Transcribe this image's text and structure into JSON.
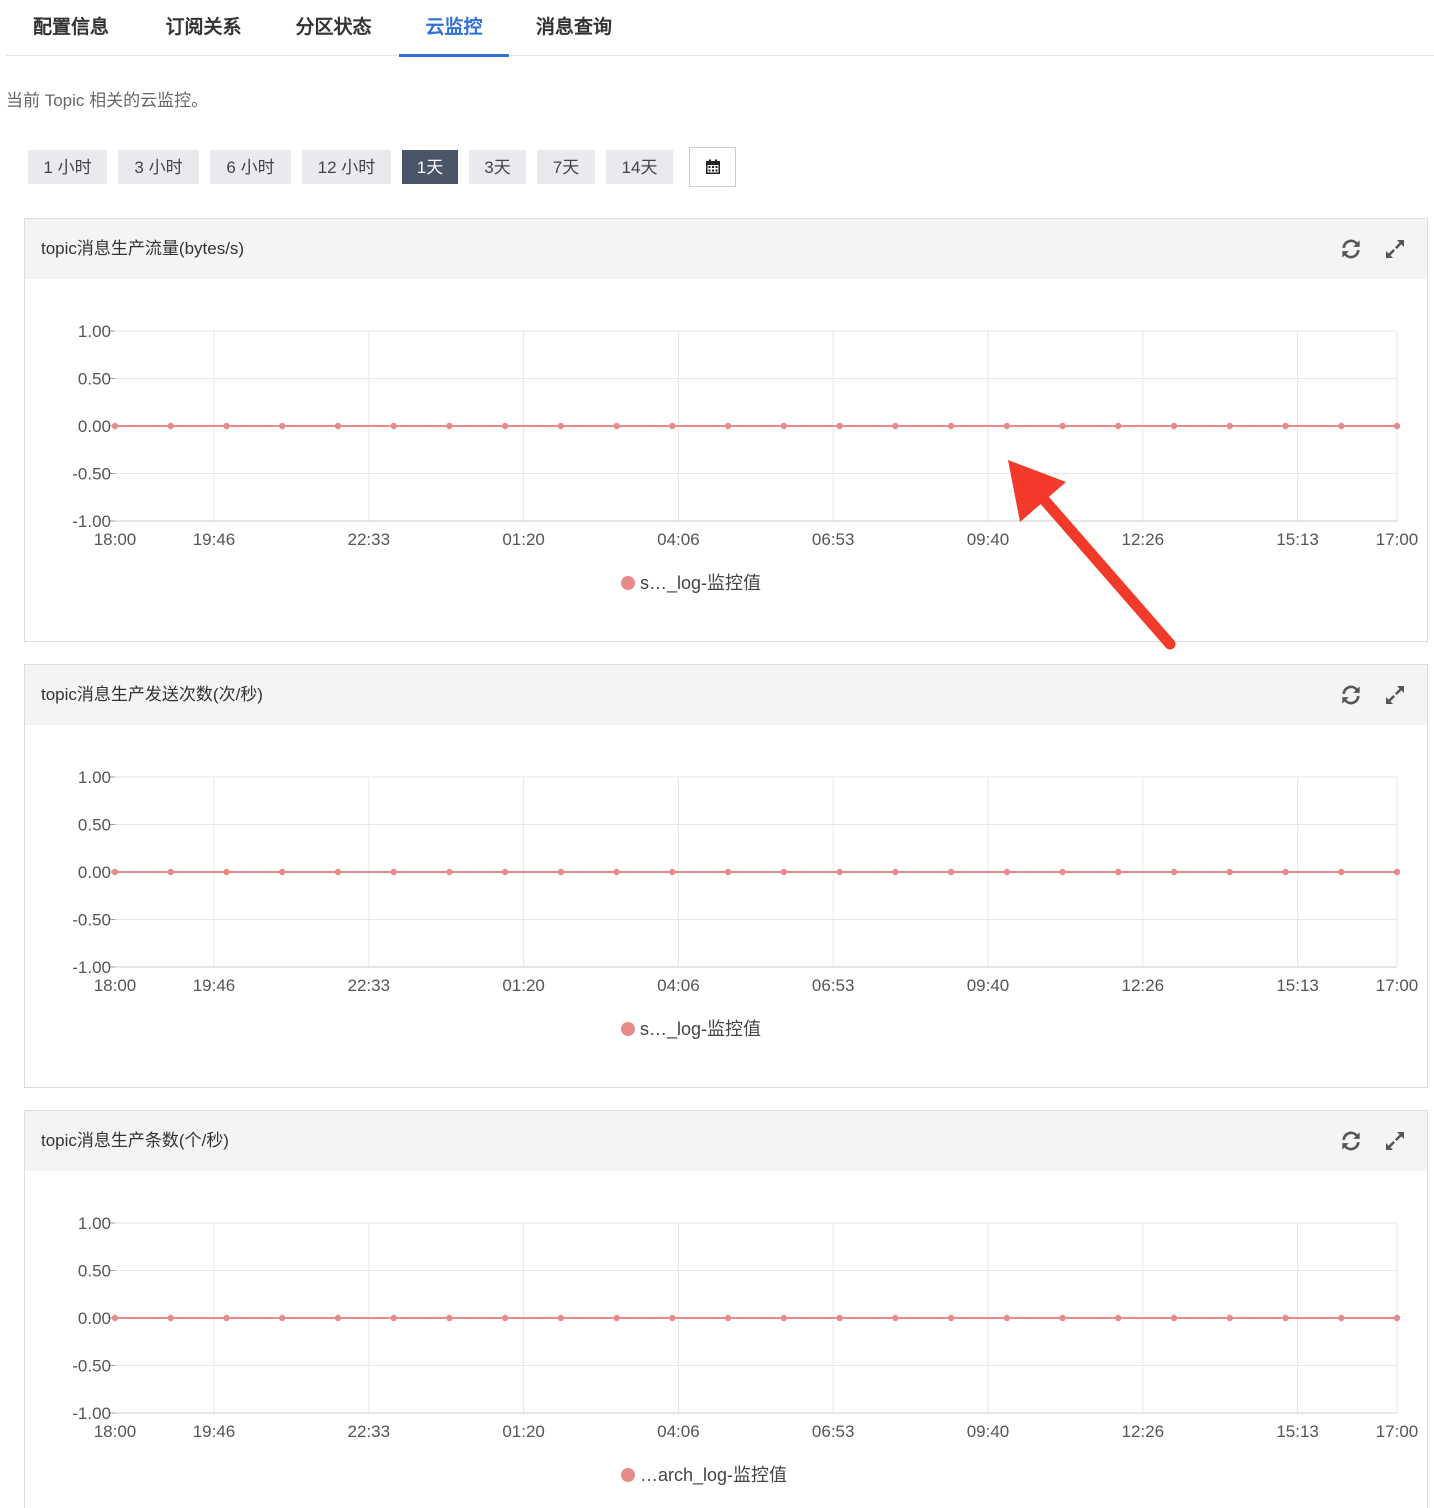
{
  "tabs": [
    {
      "label": "配置信息",
      "active": false
    },
    {
      "label": "订阅关系",
      "active": false
    },
    {
      "label": "分区状态",
      "active": false
    },
    {
      "label": "云监控",
      "active": true
    },
    {
      "label": "消息查询",
      "active": false
    }
  ],
  "description": "当前 Topic 相关的云监控。",
  "time_ranges": [
    {
      "label": "1 小时",
      "active": false
    },
    {
      "label": "3 小时",
      "active": false
    },
    {
      "label": "6 小时",
      "active": false
    },
    {
      "label": "12 小时",
      "active": false
    },
    {
      "label": "1天",
      "active": true
    },
    {
      "label": "3天",
      "active": false
    },
    {
      "label": "7天",
      "active": false
    },
    {
      "label": "14天",
      "active": false
    }
  ],
  "icons": {
    "calendar": "calendar-icon",
    "refresh": "refresh-icon",
    "expand": "expand-icon",
    "arrow": "annotation-arrow"
  },
  "colors": {
    "series": "#e88a8a",
    "active_tab": "#2f6fd8",
    "active_range": "#4a5568",
    "arrow": "#f23a2a"
  },
  "chart_data": [
    {
      "type": "line",
      "title": "topic消息生产流量(bytes/s)",
      "x": [
        "18:00",
        "19:46",
        "22:33",
        "01:20",
        "04:06",
        "06:53",
        "09:40",
        "12:26",
        "15:13",
        "17:00"
      ],
      "ylim": [
        -1,
        1
      ],
      "yticks": [
        "1.00",
        "0.50",
        "0.00",
        "-0.50",
        "-1.00"
      ],
      "grid": true,
      "legend": "bottom-center",
      "series": [
        {
          "name": "s…_log-监控值",
          "value": 0,
          "points": 24
        }
      ]
    },
    {
      "type": "line",
      "title": "topic消息生产发送次数(次/秒)",
      "x": [
        "18:00",
        "19:46",
        "22:33",
        "01:20",
        "04:06",
        "06:53",
        "09:40",
        "12:26",
        "15:13",
        "17:00"
      ],
      "ylim": [
        -1,
        1
      ],
      "yticks": [
        "1.00",
        "0.50",
        "0.00",
        "-0.50",
        "-1.00"
      ],
      "grid": true,
      "legend": "bottom-center",
      "series": [
        {
          "name": "s…_log-监控值",
          "value": 0,
          "points": 24
        }
      ]
    },
    {
      "type": "line",
      "title": "topic消息生产条数(个/秒)",
      "x": [
        "18:00",
        "19:46",
        "22:33",
        "01:20",
        "04:06",
        "06:53",
        "09:40",
        "12:26",
        "15:13",
        "17:00"
      ],
      "ylim": [
        -1,
        1
      ],
      "yticks": [
        "1.00",
        "0.50",
        "0.00",
        "-0.50",
        "-1.00"
      ],
      "grid": true,
      "legend": "bottom-center",
      "series": [
        {
          "name": "…arch_log-监控值",
          "value": 0,
          "points": 24
        }
      ]
    }
  ]
}
